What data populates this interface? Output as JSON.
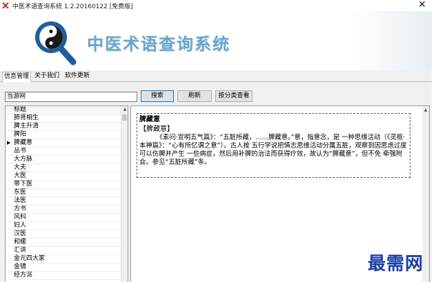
{
  "window": {
    "title": "中医术语查询系统 1.2.20160122 [免费版]",
    "close_glyph": "✕"
  },
  "banner": {
    "title": "中医术语查询系统",
    "logo_icon": "yin-yang-magnifier-icon",
    "colors": {
      "title": "#6aa6c8",
      "magnifier": "#1f5f99"
    }
  },
  "tabs": [
    {
      "label": "信息管理",
      "active": true
    },
    {
      "label": "关于我们",
      "active": false
    },
    {
      "label": "软件更新",
      "active": false
    }
  ],
  "toolbar": {
    "search_value": "当游网",
    "search_label": "搜索",
    "refresh_label": "刷新",
    "category_label": "按分类查看"
  },
  "list": {
    "header": "标题",
    "selected_index": 4,
    "items": [
      "肺肾相生",
      "脾主升清",
      "脾阳",
      "脾藏意",
      "丛书",
      "大方脉",
      "大夫",
      "大医",
      "带下医",
      "东医",
      "法医",
      "方书",
      "风科",
      "妇人",
      "汉医",
      "和缓",
      "汇讲",
      "金元四大家",
      "金镜",
      "经方派"
    ]
  },
  "detail": {
    "term": "脾藏意",
    "bracket_term": "【脾藏意】",
    "body": "《素问·宣明五气篇》：“五脏所藏，……脾藏意。”意，指意念，是 一种思维活动（《灵枢·本神篇》：“心有所忆谓之意”）。古人按 五行学说把情志思维活动分属五脏，观察到因思虑过度可以伤脾并产生 一些病症，然后用补脾的治法而获得疗效，故认为“脾藏意”，但不免 牵强附会。参见“五脏所藏”条。"
  },
  "watermark": "最需网"
}
